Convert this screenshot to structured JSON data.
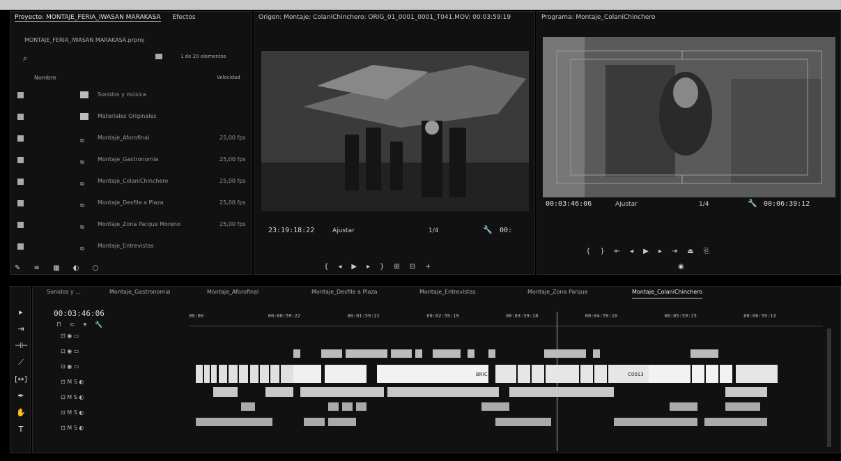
{
  "project": {
    "tab_title": "Proyecto: MONTAJE_FERIA_IWASAN MARAKASA",
    "other_tab": "Efectos",
    "file_name": "MONTAJE_FERIA_IWASAN MARAKASA.prproj",
    "item_count": "1 de 20 elementos",
    "col_name": "Nombre",
    "col_rate": "Velocidad",
    "items": [
      {
        "name": "Sonidos y música",
        "rate": "",
        "type": "folder"
      },
      {
        "name": "Materiales Originales",
        "rate": "",
        "type": "folder"
      },
      {
        "name": "Montaje_Aforofinal",
        "rate": "25,00 fps",
        "type": "sequence"
      },
      {
        "name": "Montaje_Gastronomia",
        "rate": "25,00 fps",
        "type": "sequence"
      },
      {
        "name": "Montaje_ColaniChinchero",
        "rate": "25,00 fps",
        "type": "sequence"
      },
      {
        "name": "Montaje_Desfile a Plaza",
        "rate": "25,00 fps",
        "type": "sequence"
      },
      {
        "name": "Montaje_Zona Parque Moreno",
        "rate": "25,00 fps",
        "type": "sequence"
      },
      {
        "name": "Montaje_Entrevistas",
        "rate": "",
        "type": "sequence"
      }
    ]
  },
  "source": {
    "title": "Origen: Montaje: ColaniChinchero: ORIG_01_0001_0001_T041.MOV: 00:03:59:19",
    "timecode": "23:19:18:22",
    "fit": "Ajustar",
    "quality": "1/4",
    "timecode_right": "00:"
  },
  "program": {
    "title": "Programa: Montaje_ColaniChinchero",
    "timecode": "00:03:46:06",
    "fit": "Ajustar",
    "quality": "1/4",
    "duration": "00:06:39:12"
  },
  "timeline": {
    "timecode": "00:03:46:06",
    "tabs": [
      "Sonidos y ...",
      "Montaje_Gastronomia",
      "Montaje_Aforofinal",
      "Montaje_Desfile a Plaza",
      "Montaje_Entrevistas",
      "Montaje_Zona Parque",
      "Montaje_ColaniChinchero"
    ],
    "active_tab": "Montaje_ColaniChinchero",
    "ruler": [
      "00:00",
      "00:00:59:22",
      "00:01:59:21",
      "00:02:59:19",
      "00:03:59:18",
      "00:04:59:16",
      "00:05:59:15",
      "00:06:59:13"
    ],
    "clip_labels": [
      "BRIC",
      "C0013"
    ]
  },
  "tools": [
    "selection-tool",
    "track-select-tool",
    "ripple-edit-tool",
    "razor-tool",
    "slip-tool",
    "pen-tool",
    "hand-tool",
    "type-tool"
  ],
  "colors": {
    "background": "#000000",
    "panel": "#111111",
    "clip": "#e8e8e8",
    "audio": "#c8c8c8"
  }
}
